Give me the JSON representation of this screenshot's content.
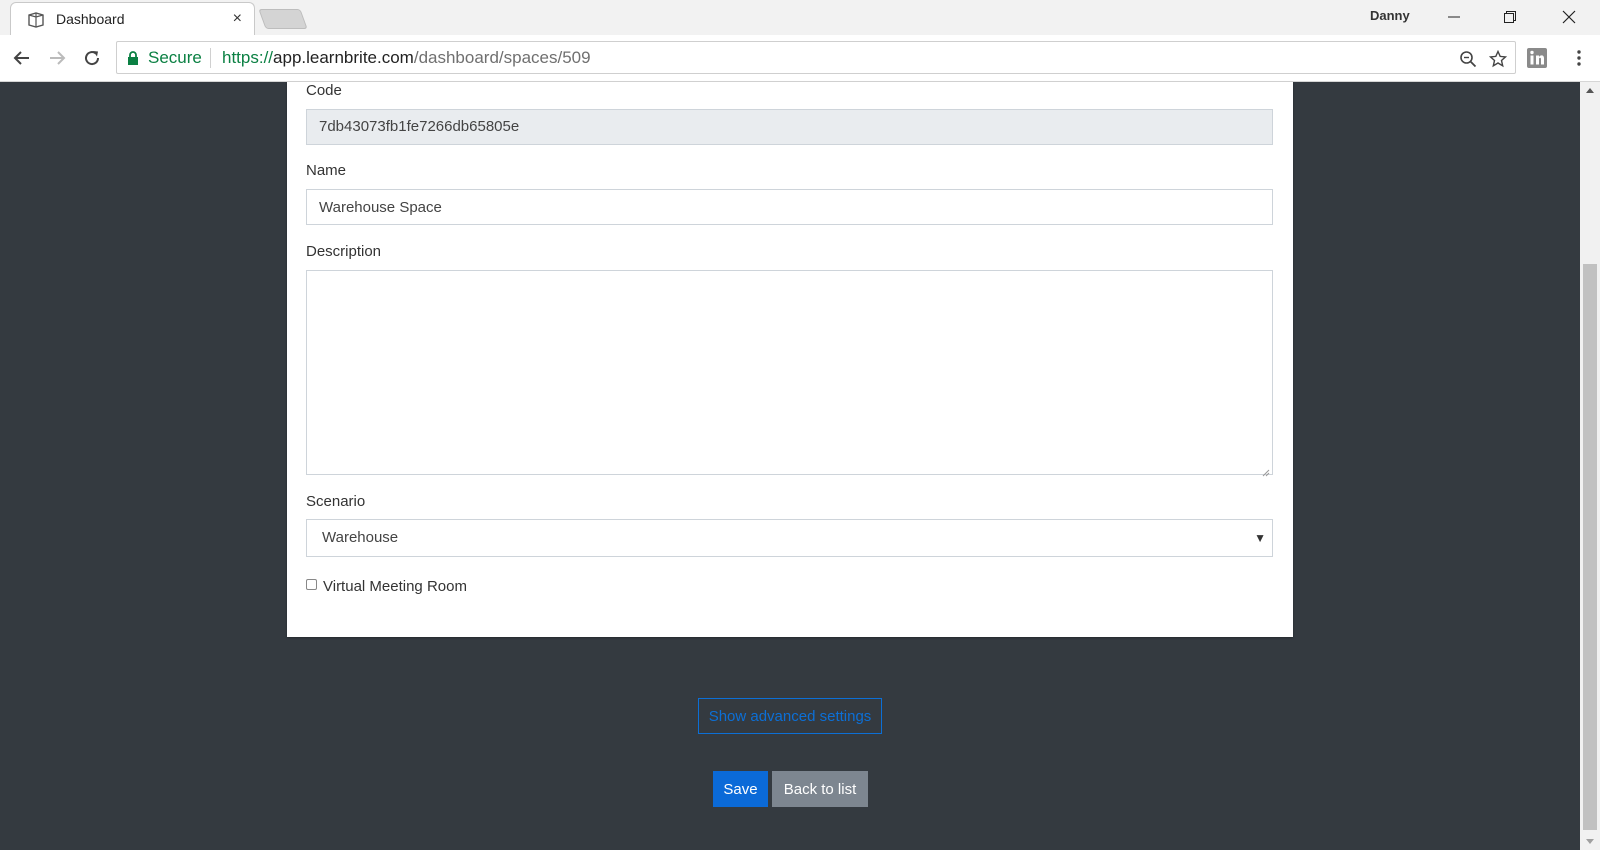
{
  "browser": {
    "tab_title": "Dashboard",
    "tab_close": "×",
    "profile_name": "Danny",
    "secure_label": "Secure",
    "url_scheme": "https://",
    "url_host": "app.learnbrite.com",
    "url_path": "/dashboard/spaces/509"
  },
  "form": {
    "code_label": "Code",
    "code_value": "7db43073fb1fe7266db65805e",
    "name_label": "Name",
    "name_value": "Warehouse Space",
    "description_label": "Description",
    "description_value": "",
    "scenario_label": "Scenario",
    "scenario_value": "Warehouse",
    "scenario_caret": "▼",
    "vmr_label": "Virtual Meeting Room"
  },
  "actions": {
    "advanced_label": "Show advanced settings",
    "save_label": "Save",
    "back_label": "Back to list"
  },
  "colors": {
    "page_bg": "#343a40",
    "primary": "#0b6ad8",
    "secondary": "#7d8690",
    "secure_green": "#0b8043"
  }
}
